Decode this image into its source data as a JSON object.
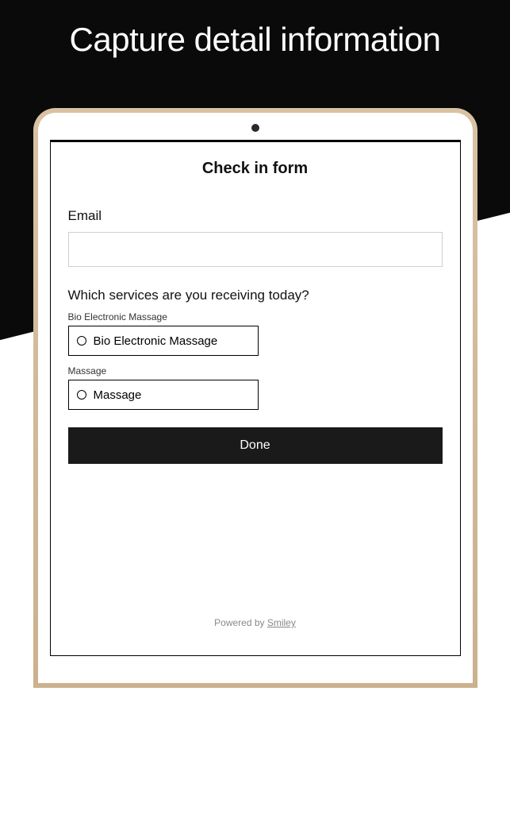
{
  "marketing": {
    "headline": "Capture detail information"
  },
  "form": {
    "title": "Check in form",
    "fields": {
      "email": {
        "label": "Email",
        "value": ""
      }
    },
    "question": {
      "label": "Which services are you receiving today?",
      "options": [
        {
          "small_label": "Bio Electronic Massage",
          "text": "Bio Electronic Massage"
        },
        {
          "small_label": "Massage",
          "text": "Massage"
        }
      ]
    },
    "submit_label": "Done"
  },
  "footer": {
    "prefix": "Powered by ",
    "brand": "Smiley"
  }
}
